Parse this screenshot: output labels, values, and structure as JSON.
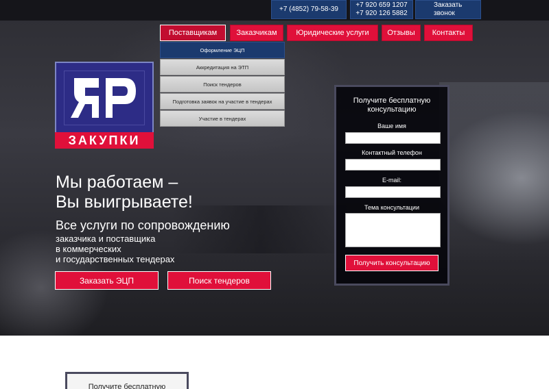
{
  "topbar": {
    "phone_main": "+7 (4852) 79-58-39",
    "phone_mobile_1": "+7 920 659 1207",
    "phone_mobile_2": "+7 920 126 5882",
    "callback_line1": "Заказать",
    "callback_line2": "звонок"
  },
  "nav": {
    "items": [
      {
        "label": "Поставщикам"
      },
      {
        "label": "Заказчикам"
      },
      {
        "label": "Юридические услуги"
      },
      {
        "label": "Отзывы"
      },
      {
        "label": "Контакты"
      }
    ],
    "dropdown": [
      {
        "label": "Оформление ЭЦП"
      },
      {
        "label": "Аккредитация на ЭТП"
      },
      {
        "label": "Поиск тендеров"
      },
      {
        "label": "Подготовка заявок на участие в тендерах"
      },
      {
        "label": "Участие в тендерах"
      }
    ]
  },
  "logo": {
    "monogram": "ЯР",
    "ribbon_text": "ЗАКУПКИ"
  },
  "hero": {
    "headline_line1": "Мы работаем –",
    "headline_line2": "Вы выигрываете!",
    "subtitle": "Все услуги по сопровождению",
    "desc_line1": "заказчика и поставщика",
    "desc_line2": "в коммерческих",
    "desc_line3": "и государственных тендерах",
    "btn_ecp": "Заказать ЭЦП",
    "btn_search": "Поиск тендеров"
  },
  "form": {
    "title_line1": "Получите бесплатную",
    "title_line2": "консультацию",
    "label_name": "Ваше имя",
    "label_phone": "Контактный телефон",
    "label_email": "E-mail:",
    "label_topic": "Тема консультации",
    "submit": "Получить консультацию"
  },
  "bottom": {
    "card_title": "Получите бесплатную"
  },
  "colors": {
    "accent_red": "#e0103a",
    "accent_blue": "#1b3a6e",
    "logo_blue": "#2d2c86"
  }
}
